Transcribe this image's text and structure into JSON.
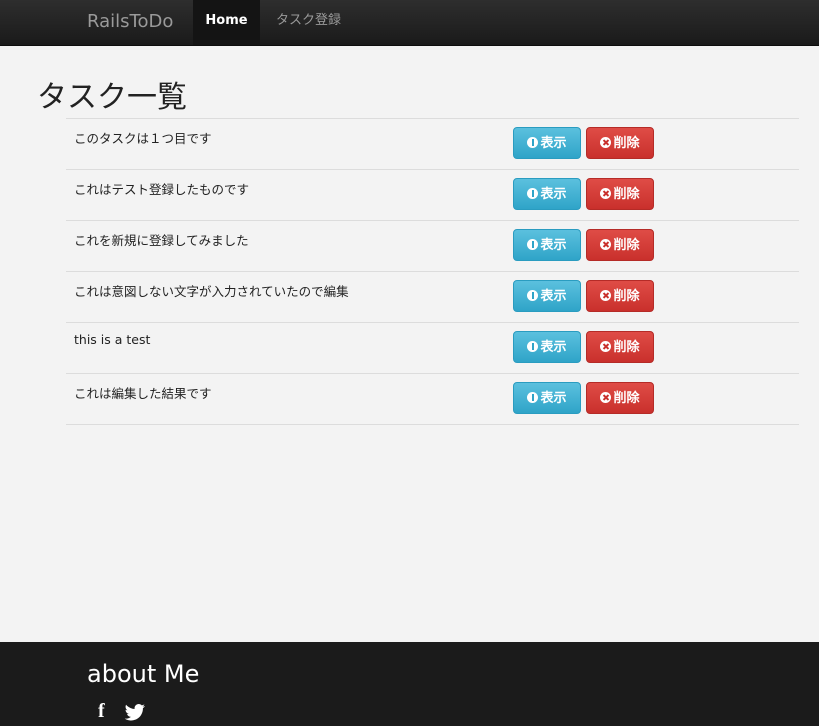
{
  "navbar": {
    "brand": "RailsToDo",
    "items": [
      {
        "label": "Home",
        "active": true
      },
      {
        "label": "タスク登録",
        "active": false
      }
    ]
  },
  "page": {
    "title": "タスク一覧"
  },
  "tasks": [
    {
      "title": "このタスクは１つ目です"
    },
    {
      "title": "これはテスト登録したものです"
    },
    {
      "title": "これを新規に登録してみました"
    },
    {
      "title": "これは意図しない文字が入力されていたので編集"
    },
    {
      "title": "this is a test"
    },
    {
      "title": "これは編集した結果です"
    }
  ],
  "actions": {
    "show_label": "表示",
    "delete_label": "削除",
    "show_color": "#5bc0de",
    "delete_color": "#d9534f"
  },
  "footer": {
    "title": "about Me",
    "social": [
      {
        "icon": "facebook-icon",
        "glyph": "f"
      },
      {
        "icon": "twitter-icon",
        "glyph": "twitter"
      }
    ]
  }
}
